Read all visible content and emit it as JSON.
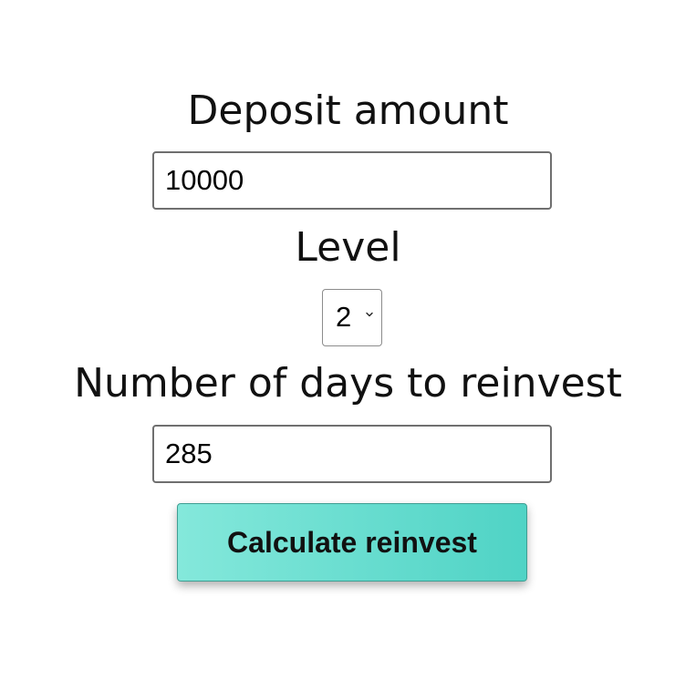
{
  "form": {
    "deposit": {
      "label": "Deposit amount",
      "value": "10000"
    },
    "level": {
      "label": "Level",
      "selected": "2",
      "icon": "chevron-down-icon"
    },
    "days": {
      "label": "Number of days to reinvest",
      "value": "285"
    },
    "submit": {
      "label": "Calculate reinvest",
      "gradient_start": "#84e8db",
      "gradient_end": "#4fd3c5"
    }
  }
}
